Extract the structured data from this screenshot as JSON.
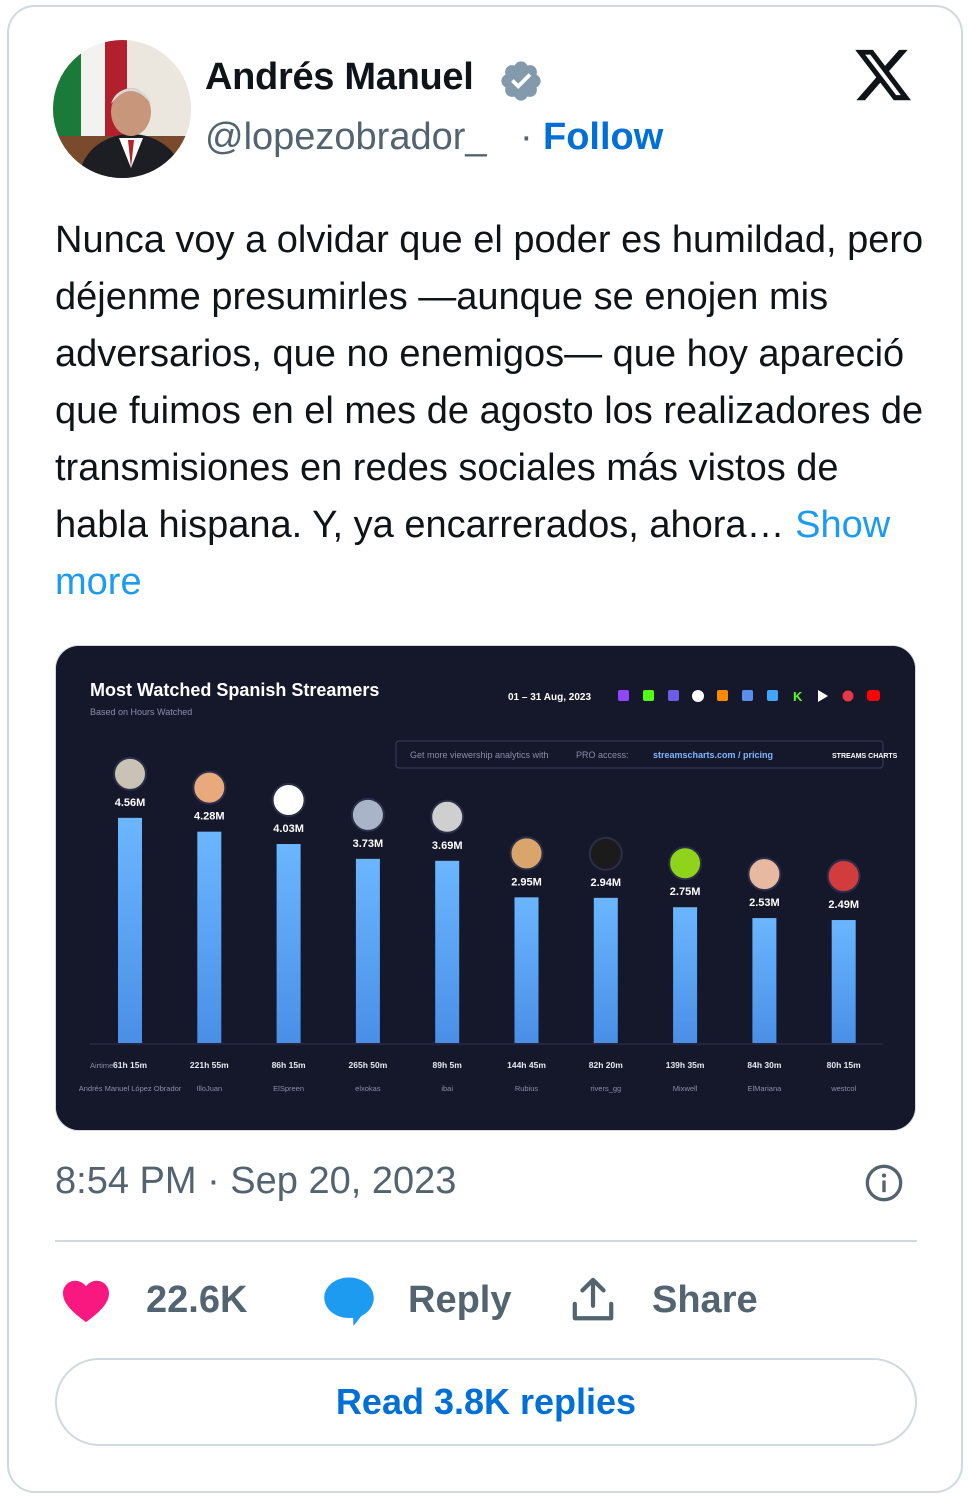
{
  "author": {
    "name": "Andrés Manuel",
    "handle": "@lopezobrador_",
    "separator": "·",
    "follow_label": "Follow"
  },
  "tweet": {
    "text": "Nunca voy a olvidar que el poder es humildad, pero déjenme presumirles —aunque se enojen mis adversarios, que no enemigos— que hoy apareció que fuimos en el mes de agosto los realizadores de transmisiones en redes sociales más vistos de habla hispana. Y, ya encarrerados, ahora…",
    "show_more": "Show more",
    "timestamp": "8:54 PM · Sep 20, 2023"
  },
  "actions": {
    "likes": "22.6K",
    "reply": "Reply",
    "share": "Share",
    "read_replies": "Read 3.8K replies"
  },
  "colors": {
    "link": "#006fd6",
    "show_more": "#1d9bf0",
    "like": "#f91880",
    "reply_icon": "#1d9bf0",
    "chart_bg": "#15172a"
  },
  "chart_data": {
    "type": "bar",
    "title": "Most Watched Spanish Streamers",
    "subtitle": "Based on Hours Watched",
    "date_range": "01 – 31 Aug, 2023",
    "promo_text": "Get more viewership analytics with",
    "promo_pro": "PRO access:",
    "promo_link": "streamscharts.com / pricing",
    "brand": "STREAMS CHARTS",
    "airtime_label": "Airtime:",
    "unit": "M hours watched",
    "categories": [
      "Andrés Manuel López Obrador",
      "IlloJuan",
      "ElSpreen",
      "elxokas",
      "ibai",
      "Rubius",
      "rivers_gg",
      "Mixwell",
      "ElMariana",
      "westcol"
    ],
    "values": [
      4.56,
      4.28,
      4.03,
      3.73,
      3.69,
      2.95,
      2.94,
      2.75,
      2.53,
      2.49
    ],
    "value_labels": [
      "4.56M",
      "4.28M",
      "4.03M",
      "3.73M",
      "3.69M",
      "2.95M",
      "2.94M",
      "2.75M",
      "2.53M",
      "2.49M"
    ],
    "airtime": [
      "61h 15m",
      "221h 55m",
      "86h 15m",
      "265h 50m",
      "89h 5m",
      "144h 45m",
      "82h 20m",
      "139h 35m",
      "84h 30m",
      "80h 15m"
    ],
    "ylim": [
      0,
      4.8
    ],
    "grid": false,
    "bar_color": "#5aa9f5"
  }
}
